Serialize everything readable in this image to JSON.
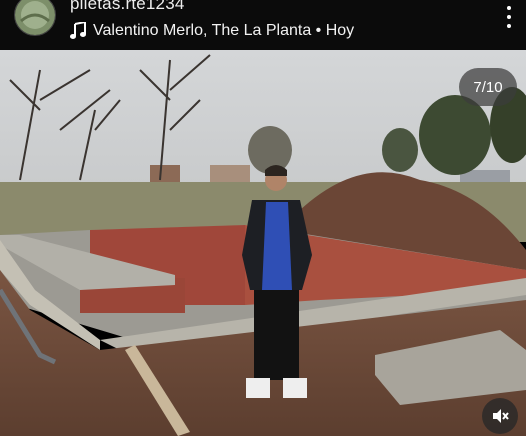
{
  "header": {
    "username": "piletas.rte1234",
    "music": "Valentino Merlo, The La Planta • Hoy",
    "more_icon": "more-vertical-icon",
    "music_icon": "music-note-icon"
  },
  "carousel": {
    "counter": "7/10"
  },
  "mute_icon": "speaker-muted-icon"
}
